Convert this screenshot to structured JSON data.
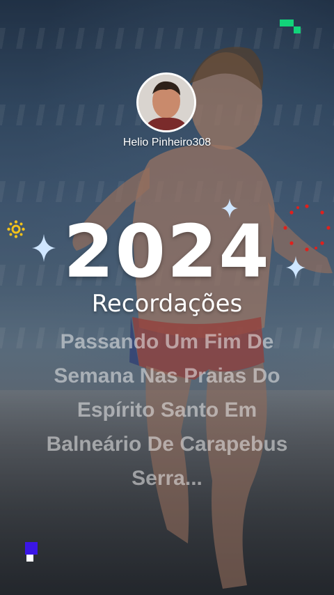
{
  "story": {
    "username": "Helio Pinheiro308",
    "year": "2024",
    "subtitle": "Recordações",
    "caption": "Passando Um Fim De Semana Nas Praias Do Espírito Santo Em Balneário De Carapebus Serra..."
  },
  "colors": {
    "accent_green": "#12d37a",
    "accent_blue": "#3b16e6",
    "sparkle": "#cfe6ff",
    "burst_red": "#e0201c",
    "sun_yellow": "#f2c21b"
  },
  "icons": [
    "avatar-photo",
    "sparkle-icon",
    "sun-icon",
    "firework-icon",
    "pixel-corner-icon"
  ]
}
